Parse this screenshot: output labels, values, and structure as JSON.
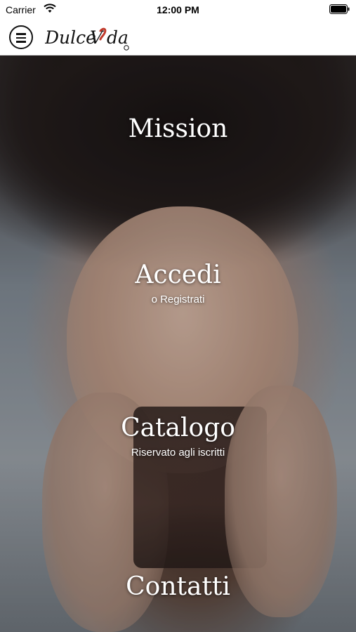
{
  "status_bar": {
    "carrier": "Carrier",
    "time": "12:00 PM",
    "icons": [
      "wifi-icon",
      "battery-icon"
    ]
  },
  "nav": {
    "logo_text": "DulceVida",
    "icons": [
      "hamburger-menu-icon"
    ]
  },
  "menu": {
    "mission": {
      "title": "Mission"
    },
    "accedi": {
      "title": "Accedi",
      "subtitle": "o Registrati"
    },
    "catalogo": {
      "title": "Catalogo",
      "subtitle": "Riservato agli iscritti"
    },
    "contatti": {
      "title": "Contatti"
    }
  },
  "colors": {
    "logo_accent": "#c0392b",
    "menu_text": "#ffffff"
  }
}
